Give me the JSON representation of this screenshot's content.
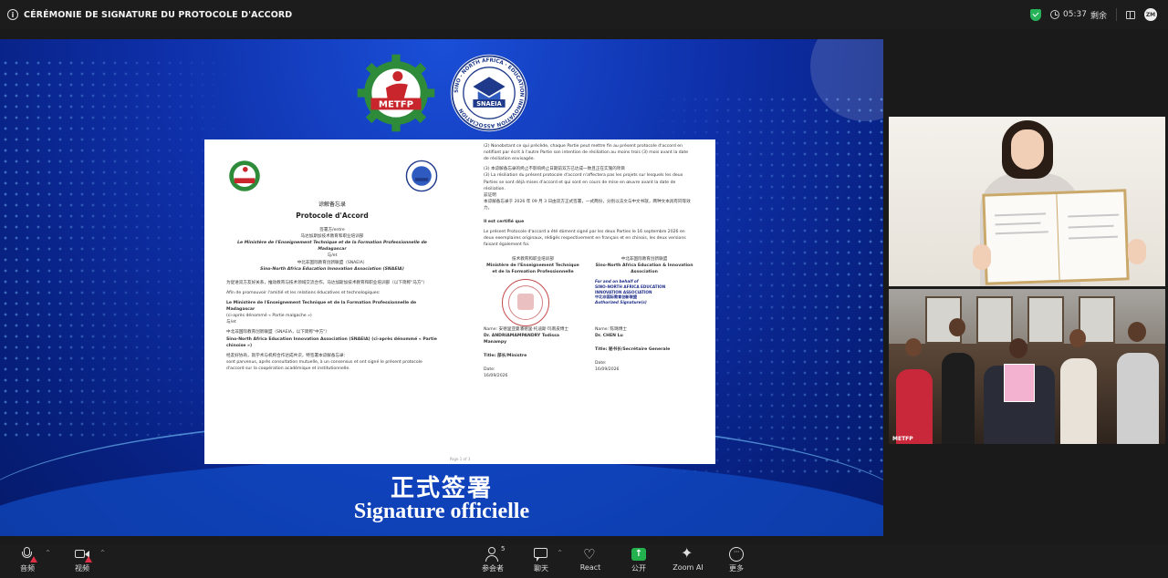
{
  "window": {
    "title": "CÉRÉMONIE DE SIGNATURE DU PROTOCOLE D'ACCORD"
  },
  "status": {
    "timer": "05:37",
    "timer_label": "剩余"
  },
  "slide": {
    "logo_left_text": "METFP",
    "logo_right_text": "SNAEIA",
    "logo_right_ring": "SINO - NORTH AFRICA · EDUCATION INNOVATION ASSOCIATION",
    "caption_cn": "正式签署",
    "caption_fr": "Signature officielle",
    "document": {
      "cn_title": "谅解备忘录",
      "title": "Protocole d'Accord",
      "left_lines": [
        "签署方/entre",
        "马达加斯加技术教育和职业培训部",
        "Le Ministère de l'Enseignement Technique et de la Formation Professionnelle de Madagascar",
        "与/et",
        "中北非国际教育创新联盟（SNAEIA）",
        "Sino-North Africa Education Innovation Association (SNAEIA)",
        "为促进双方友好关系，推动教育与技术领域交流合作，马达加斯加技术教育和职业培训部（以下简称\"马方\"）",
        "Afin de promouvoir l'amitié et les relations éducatives et technologiques:",
        "Le Ministère de l'Enseignement Technique et de la Formation Professionnelle de Madagascar",
        "(ci-après dénommé « Partie malgache »)",
        "与/et",
        "中北非国际教育创新联盟（SNAEIA，以下简称\"中方\"）",
        "Sino-North Africa Education Innovation Association (SNAEIA) (ci-après dénommé « Partie chinoise »)",
        "经友好协商，就学术与机构合作达成共识，特签署本谅解备忘录：",
        "sont parvenus, après consultation mutuelle, à un consensus et ont signé le présent protocole d'accord sur la coopération académique et institutionnelle."
      ],
      "right_lines": [
        "(2) Nonobstant ce qui précède, chaque Partie peut mettre fin au présent protocole d'accord en notifiant par écrit à l'autre Partie son intention de résiliation au moins trois (3) mois avant la date de résiliation envisagée.",
        "(3) 本谅解备忘录的终止不影响终止日期前双方已达成一致且正在实施的项目",
        "(3) La résiliation du présent protocole d'accord n'affectera pas les projets sur lesquels les deux Parties se sont déjà mises d'accord et qui sont en cours de mise en œuvre avant la date de résiliation.",
        "兹证明",
        "本谅解备忘录于 2026 年 09 月 3 日由双方正式签署，一式两份，分别以法文与中文书就，两种文本具有同等效力。",
        "Il est certifié que",
        "Le présent Protocole d'accord a été dûment signé par les deux Parties le 16 septembre 2026 en deux exemplaires originaux, rédigés respectivement en français et en chinois, les deux versions faisant également foi."
      ],
      "sig_left": {
        "org_cn": "技术教育和职业培训部",
        "org": "Ministère de l'Enseignement Technique et de la Formation Professionnelle",
        "name_line": "Name: 安德里亚曼潘德里·托迪斯·玛南皮博士",
        "name": "Dr. ANDRIAMAMPANDRY Todissa Manampy",
        "title": "Title: 部长/Ministre",
        "date_label": "Date:",
        "date": "16/09/2026"
      },
      "sig_right": {
        "org_cn": "中北非国际教育创新联盟",
        "org": "Sino-North Africa Education & Innovation Association",
        "stamp_line1": "For and on behalf of",
        "stamp_line2": "SINO-NORTH AFRICA EDUCATION INNOVATION ASSOCIATION",
        "stamp_line3": "中北非国际教育创新联盟",
        "stamp_line4": "Authorized Signature(s)",
        "name_line": "Name: 陈璐博士",
        "name": "Dr. CHEN Lu",
        "title": "Title: 秘书长/Secrétaire Generale",
        "date_label": "Date:",
        "date": "16/09/2026"
      },
      "page_footer": "Page 1 of 3"
    }
  },
  "participants": {
    "tile2_name": "METFP"
  },
  "toolbar": {
    "audio": "音频",
    "video": "视频",
    "participants": "参会者",
    "participants_count": "5",
    "chat": "聊天",
    "react": "React",
    "share": "公开",
    "zoom_ai": "Zoom AI",
    "more": "更多"
  },
  "colors": {
    "share_green": "#23b14d",
    "alert_red": "#e02e45",
    "slide_blue": "#0e2fa8",
    "metfp_red": "#c8252c",
    "metfp_green": "#2e8b3a",
    "snaeia_navy": "#1f3a8a"
  }
}
